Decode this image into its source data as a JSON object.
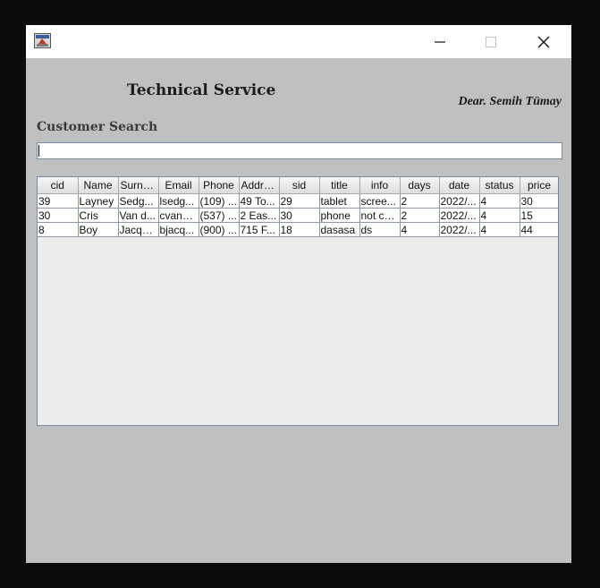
{
  "window": {
    "icon": "java-app-icon",
    "controls": {
      "minimize": "minimize-icon",
      "maximize": "maximize-icon",
      "close": "close-icon"
    }
  },
  "header": {
    "title": "Technical Service",
    "greeting": "Dear. Semih Tümay"
  },
  "search": {
    "label": "Customer Search",
    "value": ""
  },
  "table": {
    "columns": [
      "cid",
      "Name",
      "Surna...",
      "Email",
      "Phone",
      "Addre...",
      "sid",
      "title",
      "info",
      "days",
      "date",
      "status",
      "price"
    ],
    "rows": [
      [
        "39",
        "Layney",
        "Sedg...",
        "lsedg...",
        "(109) ...",
        "49 To...",
        "29",
        "tablet",
        "scree...",
        "2",
        "2022/...",
        "4",
        "30"
      ],
      [
        "30",
        "Cris",
        "Van d...",
        "cvand...",
        "(537) ...",
        "2 Eas...",
        "30",
        "phone",
        "not ch...",
        "2",
        "2022/...",
        "4",
        "15"
      ],
      [
        "8",
        "Boy",
        "Jacqu...",
        "bjacq...",
        "(900) ...",
        "715 F...",
        "18",
        "dasasa",
        "ds",
        "4",
        "2022/...",
        "4",
        "44"
      ]
    ]
  },
  "colors": {
    "window_bg": "#c0c0c0",
    "table_empty_bg": "#ececec",
    "outer_bg": "#0c0c0c"
  }
}
